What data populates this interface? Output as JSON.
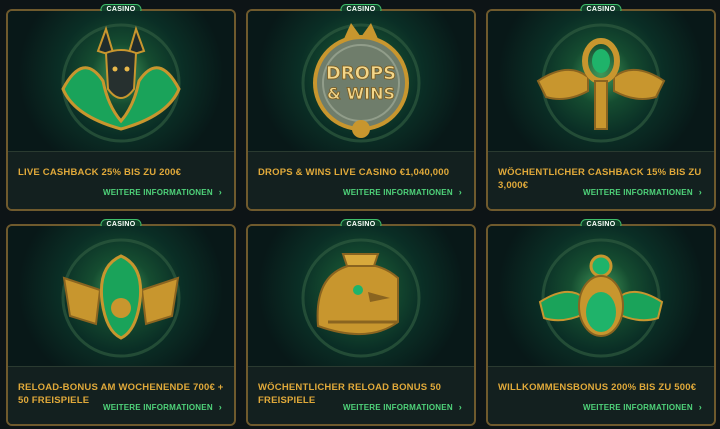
{
  "badge_label": "CASINO",
  "more_label": "WEITERE INFORMATIONEN",
  "colors": {
    "accent_gold": "#e0a93a",
    "link_green": "#4fd37a",
    "card_border": "#6f5a2d"
  },
  "cards": [
    {
      "title": "LIVE CASHBACK 25% BIS ZU 200€",
      "icon": "anubis-icon"
    },
    {
      "title": "DROPS & WINS LIVE CASINO €1,040,000",
      "icon": "drops-and-wins-medallion-icon",
      "art_text_1": "DROPS",
      "art_text_2": "& WINS"
    },
    {
      "title": "WÖCHENTLICHER CASHBACK 15% BIS ZU 3,000€",
      "icon": "winged-ankh-icon"
    },
    {
      "title": "RELOAD-BONUS AM WOCHENENDE 700€ + 50 FREISPIELE",
      "icon": "winged-cobra-icon"
    },
    {
      "title": "WÖCHENTLICHER RELOAD BONUS 50 FREISPIELE",
      "icon": "horus-falcon-icon"
    },
    {
      "title": "WILLKOMMENSBONUS 200% BIS ZU 500€",
      "icon": "scarab-icon"
    }
  ]
}
